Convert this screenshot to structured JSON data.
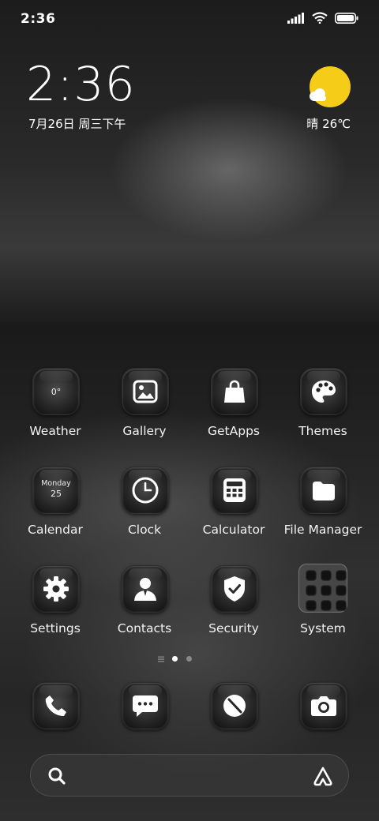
{
  "status_bar": {
    "time": "2:36"
  },
  "clock_widget": {
    "time": "2:36",
    "date": "7月26日 周三下午"
  },
  "weather_widget": {
    "text": "晴 26℃"
  },
  "apps": {
    "weather": {
      "label": "Weather",
      "icon_text": "0°"
    },
    "gallery": {
      "label": "Gallery"
    },
    "getapps": {
      "label": "GetApps"
    },
    "themes": {
      "label": "Themes"
    },
    "calendar": {
      "label": "Calendar",
      "icon_day": "Monday",
      "icon_date": "25"
    },
    "clock": {
      "label": "Clock"
    },
    "calculator": {
      "label": "Calculator"
    },
    "file_manager": {
      "label": "File Manager"
    },
    "settings": {
      "label": "Settings"
    },
    "contacts": {
      "label": "Contacts"
    },
    "security": {
      "label": "Security"
    },
    "system": {
      "label": "System"
    }
  },
  "dock": [
    "phone-icon",
    "messages-icon",
    "browser-icon",
    "camera-icon"
  ],
  "colors": {
    "sun": "#f5cc17",
    "label": "#f2f2f2"
  }
}
